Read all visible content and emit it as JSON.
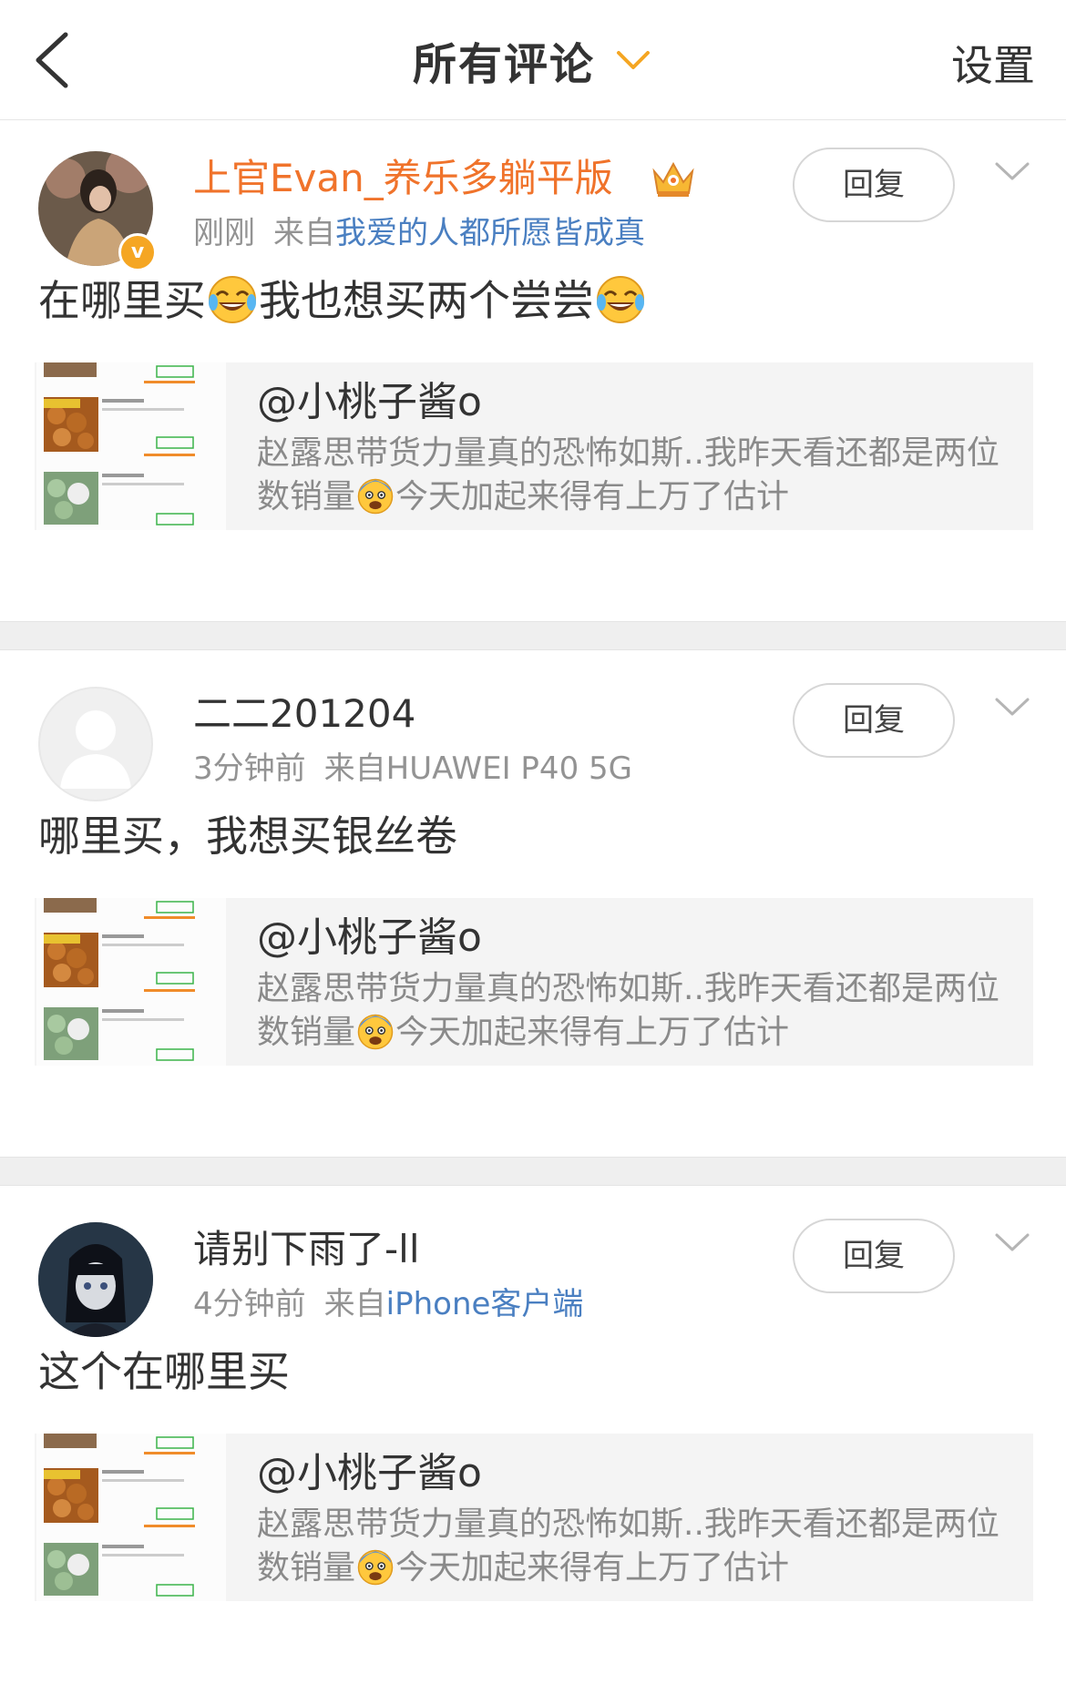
{
  "nav": {
    "title": "所有评论",
    "settings_label": "设置",
    "accent": "#f5a623"
  },
  "comments": [
    {
      "name": "上官Evan_养乐多躺平版",
      "time": "刚刚",
      "source_prefix": "来自",
      "source": "我爱的人都所愿皆成真",
      "text_parts": [
        "在哪里买",
        "我也想买两个尝尝"
      ],
      "reply_label": "回复",
      "quote": {
        "name": "@小桃子酱o",
        "text_a": "赵露思带货力量真的恐怖如斯..我昨天看还都是两位数销量",
        "text_b": "今天加起来得有上万了估计"
      }
    },
    {
      "name": "二二201204",
      "time": "3分钟前",
      "source_prefix": "来自",
      "source": "HUAWEI P40 5G",
      "text": "哪里买，我想买银丝卷",
      "reply_label": "回复",
      "quote": {
        "name": "@小桃子酱o",
        "text_a": "赵露思带货力量真的恐怖如斯..我昨天看还都是两位数销量",
        "text_b": "今天加起来得有上万了估计"
      }
    },
    {
      "name": "请别下雨了-ll",
      "time": "4分钟前",
      "source_prefix": "来自",
      "source": "iPhone客户端",
      "text": "这个在哪里买",
      "reply_label": "回复",
      "quote": {
        "name": "@小桃子酱o",
        "text_a": "赵露思带货力量真的恐怖如斯..我昨天看还都是两位数销量",
        "text_b": "今天加起来得有上万了估计"
      }
    }
  ],
  "thumb": {
    "item1_price": "¥24",
    "item1_tag": "已抢光",
    "item1_sold": "242店长发红包剁手价",
    "item2_title": "红糖鸡枞花卷",
    "item2_price": "¥23.5",
    "item2_sold": "7506件带货红包剁手价",
    "item3_title": "叶儿粑（咸馅儿）",
    "item3_price": "¥23.5",
    "button_label": "抽奖补货"
  },
  "icons": {
    "back": "back-arrow-icon",
    "title_dropdown": "chevron-down-icon",
    "more": "chevron-down-icon",
    "vip_crown": "crown-icon",
    "verified": "verified-badge-icon",
    "laugh": "laughing-tears-emoji",
    "fear": "fearful-emoji",
    "default_avatar": "person-icon"
  },
  "colors": {
    "vip_name": "#f0732b",
    "link": "#4a7fc1",
    "meta": "#939393",
    "quote_bg": "#f4f4f4",
    "separator": "#efefef"
  }
}
